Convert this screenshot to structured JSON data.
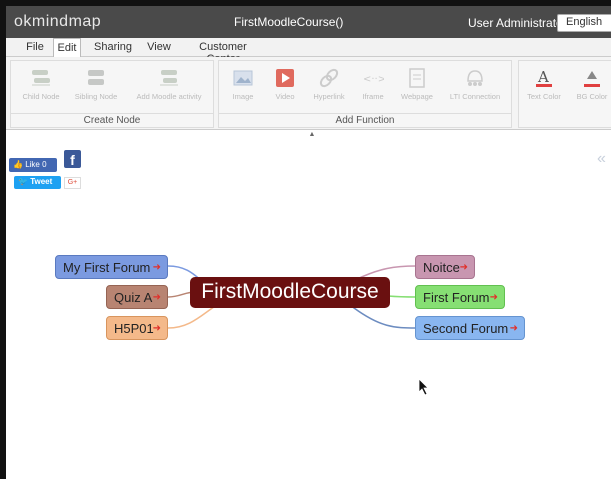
{
  "app": {
    "logo": "okmindmap",
    "document_title": "FirstMoodleCourse()",
    "user": "User Administrator",
    "language": "English"
  },
  "menu": {
    "tabs": [
      {
        "label": "File"
      },
      {
        "label": "Edit"
      },
      {
        "label": "Sharing"
      },
      {
        "label": "View"
      },
      {
        "label": "Customer Center"
      }
    ],
    "active": "Edit"
  },
  "ribbon": {
    "create_node": {
      "label": "Create Node",
      "tools": [
        {
          "label": "Child Node",
          "icon": "child-node-icon"
        },
        {
          "label": "Sibling Node",
          "icon": "sibling-node-icon"
        },
        {
          "label": "Add Moodle activity",
          "icon": "moodle-activity-icon"
        }
      ]
    },
    "add_function": {
      "label": "Add Function",
      "tools": [
        {
          "label": "Image",
          "icon": "image-icon"
        },
        {
          "label": "Video",
          "icon": "video-icon"
        },
        {
          "label": "Hyperlink",
          "icon": "hyperlink-icon"
        },
        {
          "label": "Iframe",
          "icon": "iframe-icon"
        },
        {
          "label": "Webpage",
          "icon": "webpage-icon"
        },
        {
          "label": "LTI Connection",
          "icon": "lti-icon"
        }
      ]
    },
    "format": {
      "tools": [
        {
          "label": "Text Color",
          "icon": "text-color-icon"
        },
        {
          "label": "BG Color",
          "icon": "bg-color-icon"
        }
      ]
    }
  },
  "social": {
    "like": "Like 0",
    "tweet": "Tweet",
    "facebook": "f",
    "gplus": "G+"
  },
  "mindmap": {
    "root": "FirstMoodleCourse",
    "left_nodes": [
      {
        "label": "My First Forum",
        "color": "#7b9ae0"
      },
      {
        "label": "Quiz A",
        "color": "#b88472"
      },
      {
        "label": "H5P01",
        "color": "#f4b98a"
      }
    ],
    "right_nodes": [
      {
        "label": "Noitce",
        "color": "#c896b0"
      },
      {
        "label": "First Forum",
        "color": "#86df73"
      },
      {
        "label": "Second Forum",
        "color": "#89b6f0"
      }
    ],
    "root_color": "#6a1010"
  }
}
